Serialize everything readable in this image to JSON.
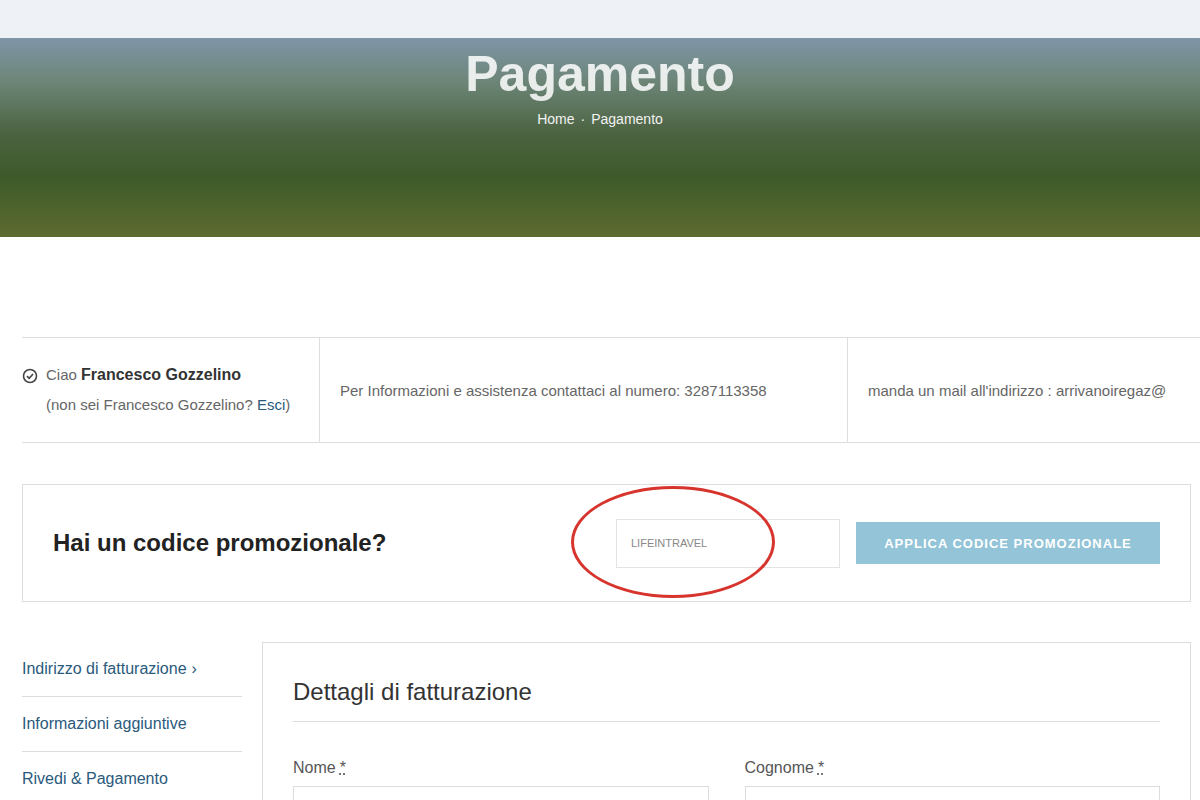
{
  "page": {
    "title": "Pagamento",
    "breadcrumb": [
      "Home",
      "Pagamento"
    ],
    "breadcrumb_separator": "·"
  },
  "info_bar": {
    "greeting": "Ciao",
    "user_name": "Francesco Gozzelino",
    "not_you": "(non sei Francesco Gozzelino?",
    "logout_link": "Esci",
    "not_you_end": ")",
    "phone_info": "Per Informazioni e assistenza contattaci al numero: 3287113358",
    "email_info": "manda un mail all'indirizzo : arrivanoiregaz@"
  },
  "promo": {
    "question": "Hai un codice promozionale?",
    "code": "LIFEINTRAVEL",
    "button": "APPLICA CODICE PROMOZIONALE"
  },
  "steps": [
    {
      "label": "Indirizzo di fatturazione",
      "arrow": "›",
      "selected": true
    },
    {
      "label": "Informazioni aggiuntive",
      "selected": false
    },
    {
      "label": "Rivedi & Pagamento",
      "selected": false
    }
  ],
  "billing": {
    "title": "Dettagli di fatturazione",
    "fields": [
      {
        "label": "Nome",
        "required": "*"
      },
      {
        "label": "Cognome",
        "required": "*"
      }
    ]
  }
}
